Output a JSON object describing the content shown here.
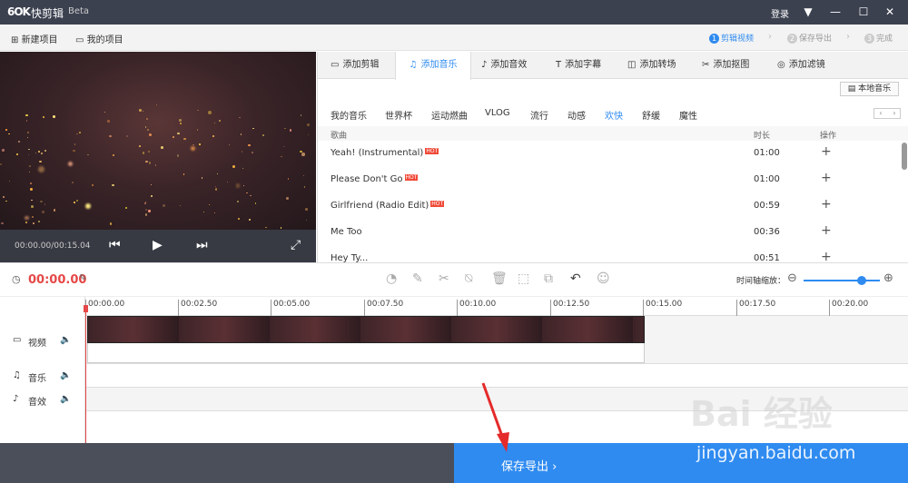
{
  "app": {
    "logo": "6OK",
    "title": "快剪辑",
    "beta": "Beta",
    "login": "登录"
  },
  "toolbar": {
    "new_project": "新建项目",
    "my_projects": "我的项目"
  },
  "steps": [
    {
      "num": "1",
      "label": "剪辑视频",
      "active": true
    },
    {
      "num": "2",
      "label": "保存导出",
      "active": false
    },
    {
      "num": "3",
      "label": "完成",
      "active": false
    }
  ],
  "player": {
    "timecode": "00:00.00/00:15.04"
  },
  "tabs": [
    {
      "label": "添加剪辑",
      "icon": "video-camera-icon"
    },
    {
      "label": "添加音乐",
      "icon": "music-note-icon",
      "active": true
    },
    {
      "label": "添加音效",
      "icon": "sound-effect-icon"
    },
    {
      "label": "添加字幕",
      "icon": "text-icon"
    },
    {
      "label": "添加转场",
      "icon": "transition-icon"
    },
    {
      "label": "添加抠图",
      "icon": "cutout-icon"
    },
    {
      "label": "添加滤镜",
      "icon": "filter-icon"
    }
  ],
  "local_music": "本地音乐",
  "categories": [
    "我的音乐",
    "世界杯",
    "运动燃曲",
    "VLOG",
    "流行",
    "动感",
    "欢快",
    "舒缓",
    "魔性"
  ],
  "active_category": "欢快",
  "table": {
    "headers": {
      "song": "歌曲",
      "duration": "时长",
      "action": "操作"
    },
    "rows": [
      {
        "song": "Yeah! (Instrumental)",
        "hot": "HOT",
        "duration": "01:00"
      },
      {
        "song": "Please Don't Go",
        "hot": "HOT",
        "duration": "01:00"
      },
      {
        "song": "Girlfriend (Radio Edit)",
        "hot": "HOT",
        "duration": "00:59"
      },
      {
        "song": "Me Too",
        "hot": "",
        "duration": "00:36"
      },
      {
        "song": "Hey Ty...",
        "hot": "",
        "duration": "00:51"
      }
    ]
  },
  "edit": {
    "current_time": "00:00.00",
    "zoom_label": "时间轴缩放：",
    "zoom_level": 0.7
  },
  "ruler": [
    "00:00.00",
    "00:02.50",
    "00:05.00",
    "00:07.50",
    "00:10.00",
    "00:12.50",
    "00:15.00",
    "00:17.50",
    "00:20.00"
  ],
  "tracks": [
    {
      "name": "视频",
      "icon": "video-icon"
    },
    {
      "name": "音乐",
      "icon": "music-icon"
    },
    {
      "name": "音效",
      "icon": "sfx-icon"
    }
  ],
  "footer": {
    "export": "保存导出"
  },
  "watermark": {
    "main": "Bai 经验",
    "sub": "jingyan.baidu.com"
  },
  "colors": {
    "accent": "#2f8bf0",
    "titlebar": "#3c4150",
    "playhead": "#e54848"
  }
}
